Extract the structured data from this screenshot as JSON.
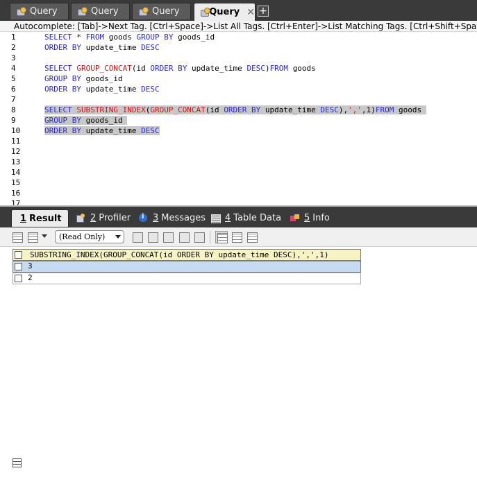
{
  "tabs": [
    {
      "label": "Query",
      "active": false,
      "icon": "query-icon"
    },
    {
      "label": "Query",
      "active": false,
      "icon": "query-icon"
    },
    {
      "label": "Query",
      "active": false,
      "icon": "query-icon"
    },
    {
      "label": "Query",
      "active": true,
      "icon": "query-icon",
      "close": "✕"
    }
  ],
  "add_tab_label": "+",
  "autocomplete_hint": "Autocomplete: [Tab]->Next Tag. [Ctrl+Space]->List All Tags. [Ctrl+Enter]->List Matching Tags. [Ctrl+Shift+Space]->",
  "editor": {
    "line_numbers": [
      "1",
      "2",
      "3",
      "4",
      "5",
      "6",
      "7",
      "8",
      "9",
      "10",
      "11",
      "12",
      "13",
      "14",
      "15",
      "16",
      "17"
    ],
    "lines": [
      [
        {
          "t": "SELECT ",
          "c": "kw"
        },
        {
          "t": "* ",
          "c": "id"
        },
        {
          "t": "FROM ",
          "c": "kw"
        },
        {
          "t": "goods ",
          "c": "id"
        },
        {
          "t": "GROUP BY ",
          "c": "kw"
        },
        {
          "t": "goods_id",
          "c": "id"
        }
      ],
      [
        {
          "t": "ORDER BY ",
          "c": "kw"
        },
        {
          "t": "update_time ",
          "c": "id"
        },
        {
          "t": "DESC",
          "c": "kw"
        }
      ],
      [],
      [
        {
          "t": "SELECT ",
          "c": "kw"
        },
        {
          "t": "GROUP_CONCAT",
          "c": "fn"
        },
        {
          "t": "(id ",
          "c": "id"
        },
        {
          "t": "ORDER BY ",
          "c": "kw"
        },
        {
          "t": "update_time ",
          "c": "id"
        },
        {
          "t": "DESC",
          "c": "kw"
        },
        {
          "t": ")",
          "c": "id"
        },
        {
          "t": "FROM ",
          "c": "kw"
        },
        {
          "t": "goods",
          "c": "id"
        }
      ],
      [
        {
          "t": "GROUP BY ",
          "c": "kw"
        },
        {
          "t": "goods_id",
          "c": "id"
        }
      ],
      [
        {
          "t": "ORDER BY ",
          "c": "kw"
        },
        {
          "t": "update_time ",
          "c": "id"
        },
        {
          "t": "DESC",
          "c": "kw"
        }
      ],
      [],
      [
        {
          "t": "SELECT ",
          "c": "kw"
        },
        {
          "t": "SUBSTRING_INDEX",
          "c": "fn"
        },
        {
          "t": "(",
          "c": "id"
        },
        {
          "t": "GROUP_CONCAT",
          "c": "fn"
        },
        {
          "t": "(id ",
          "c": "id"
        },
        {
          "t": "ORDER BY ",
          "c": "kw"
        },
        {
          "t": "update_time ",
          "c": "id"
        },
        {
          "t": "DESC",
          "c": "kw"
        },
        {
          "t": "),",
          "c": "id"
        },
        {
          "t": "','",
          "c": "str"
        },
        {
          "t": ",1)",
          "c": "id"
        },
        {
          "t": "FROM ",
          "c": "kw"
        },
        {
          "t": "goods ",
          "c": "id"
        }
      ],
      [
        {
          "t": "GROUP BY ",
          "c": "kw"
        },
        {
          "t": "goods_id ",
          "c": "id"
        }
      ],
      [
        {
          "t": "ORDER BY ",
          "c": "kw"
        },
        {
          "t": "update_time ",
          "c": "id"
        },
        {
          "t": "DESC",
          "c": "kw"
        }
      ],
      [],
      [],
      [],
      [],
      [],
      [],
      []
    ],
    "selected_lines": [
      7,
      8,
      9
    ]
  },
  "result_tabs": [
    {
      "num": "1",
      "label": "Result",
      "icon": "result-grid-icon",
      "active": true
    },
    {
      "num": "2",
      "label": "Profiler",
      "icon": "profiler-icon",
      "active": false
    },
    {
      "num": "3",
      "label": "Messages",
      "icon": "messages-icon",
      "active": false
    },
    {
      "num": "4",
      "label": "Table Data",
      "icon": "table-data-icon",
      "active": false
    },
    {
      "num": "5",
      "label": "Info",
      "icon": "info-icon",
      "active": false
    }
  ],
  "result_toolbar": {
    "readonly_label": "(Read Only)"
  },
  "result_grid": {
    "column_header": "SUBSTRING_INDEX(GROUP_CONCAT(id ORDER BY update_time DESC),',',1)",
    "rows": [
      "3",
      "2"
    ],
    "selected_row": 0
  }
}
